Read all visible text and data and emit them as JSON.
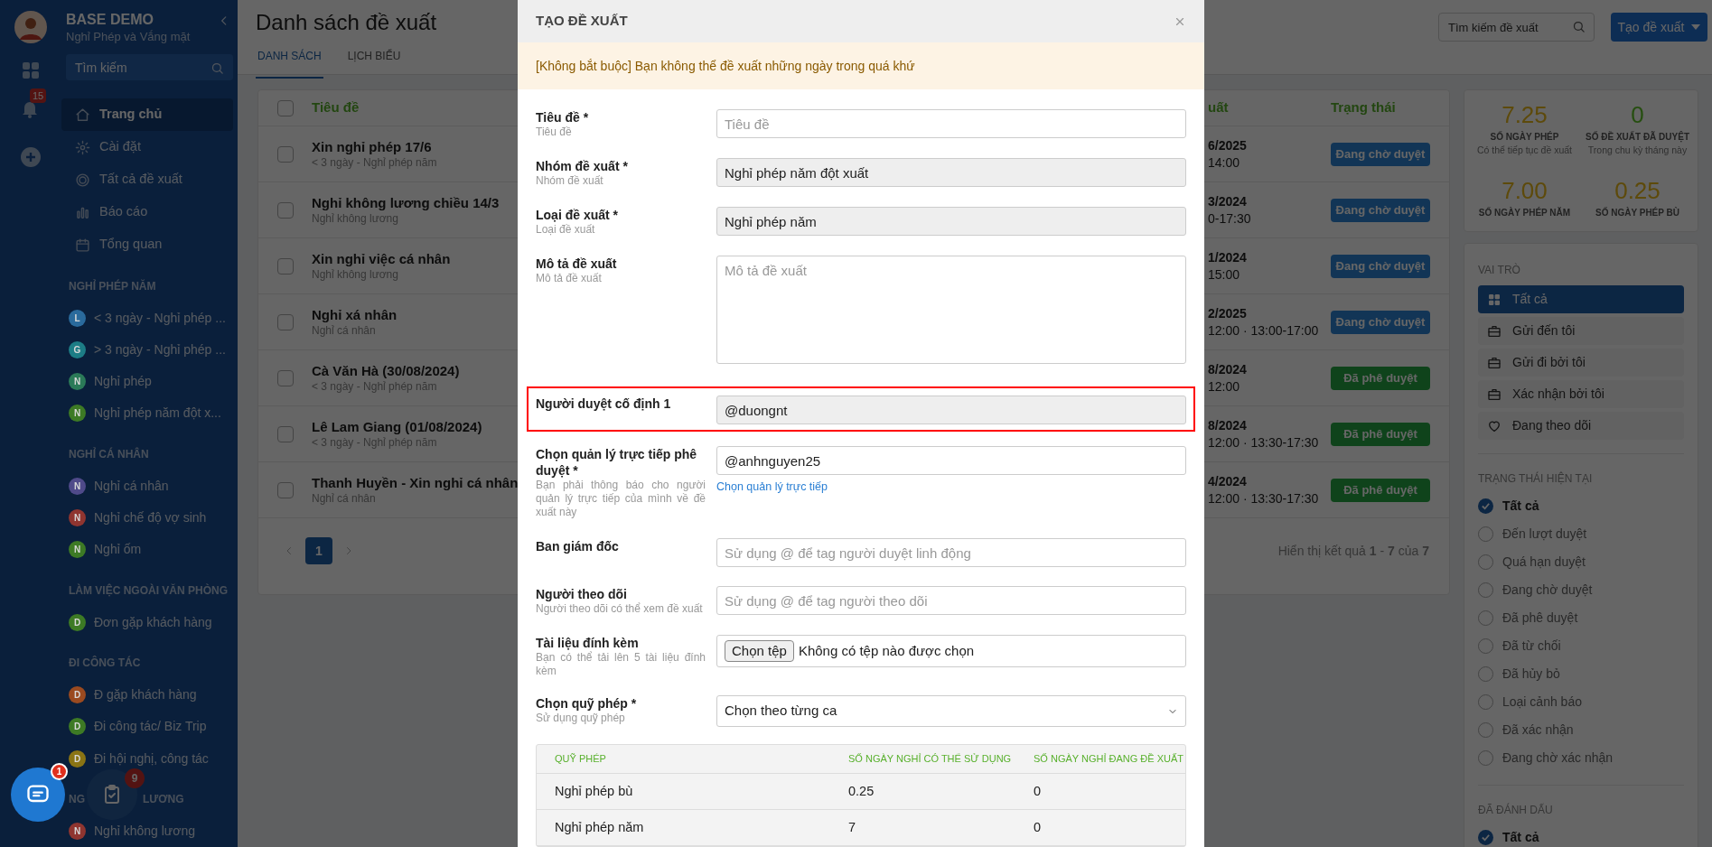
{
  "sidebar": {
    "app_title": "BASE DEMO",
    "app_subtitle": "Nghỉ Phép và Vắng mặt",
    "notification_count": "15",
    "search": {
      "placeholder": "Tìm kiếm"
    },
    "nav": [
      {
        "label": "Trang chủ",
        "selected": true
      },
      {
        "label": "Cài đặt",
        "selected": false
      },
      {
        "label": "Tất cả đề xuất",
        "selected": false
      },
      {
        "label": "Báo cáo",
        "selected": false
      },
      {
        "label": "Tổng quan",
        "selected": false
      }
    ],
    "sections": [
      {
        "heading": "NGHỈ PHÉP NĂM",
        "items": [
          {
            "letter": "L",
            "label": "< 3 ngày - Nghỉ phép ...",
            "color": "#2a6a9c"
          },
          {
            "letter": "G",
            "label": "> 3 ngày - Nghỉ phép ...",
            "color": "#1d7d86"
          },
          {
            "letter": "N",
            "label": "Nghỉ phép",
            "color": "#2b7a58"
          },
          {
            "letter": "N",
            "label": "Nghỉ phép năm đột x...",
            "color": "#3d7a25"
          }
        ]
      },
      {
        "heading": "NGHỈ CÁ NHÂN",
        "items": [
          {
            "letter": "N",
            "label": "Nghỉ cá nhân",
            "color": "#4f4a8a"
          },
          {
            "letter": "N",
            "label": "Nghỉ chế độ vợ sinh",
            "color": "#8f3530"
          },
          {
            "letter": "N",
            "label": "Nghỉ ốm",
            "color": "#3d7a25"
          }
        ]
      },
      {
        "heading": "LÀM VIỆC NGOÀI VĂN PHÒNG",
        "items": [
          {
            "letter": "D",
            "label": "Đơn gặp khách hàng",
            "color": "#3d7a25"
          }
        ]
      },
      {
        "heading": "ĐI CÔNG TÁC",
        "items": [
          {
            "letter": "D",
            "label": "Đ gặp khách hàng",
            "color": "#9a4a20"
          },
          {
            "letter": "D",
            "label": "Đi công tác/ Biz Trip",
            "color": "#3d7a25"
          },
          {
            "letter": "D",
            "label": "Đi hội nghị, công tác",
            "color": "#8a7414"
          }
        ]
      },
      {
        "heading_parts": [
          "NG",
          "LƯƠNG"
        ],
        "items": [
          {
            "letter": "N",
            "label": "Nghỉ không lương",
            "color": "#8f3530"
          }
        ]
      }
    ]
  },
  "floating": {
    "chat_badge": "1",
    "tasks_badge": "9"
  },
  "page": {
    "title": "Danh sách đề xuất",
    "tabs": [
      {
        "label": "DANH SÁCH",
        "selected": true
      },
      {
        "label": "LỊCH BIỂU",
        "selected": false
      }
    ],
    "search": {
      "placeholder": "Tìm kiếm đề xuất"
    },
    "create_button": "Tạo đề xuất"
  },
  "table": {
    "select_all": {
      "checked": false
    },
    "columns": [
      "Tiêu đề",
      "uất",
      "Trạng thái"
    ],
    "rows": [
      {
        "checked": false,
        "title": "Xin nghỉ phép 17/6",
        "subtitle": "< 3 ngày - Nghỉ phép năm",
        "date": "6/2025",
        "time": "14:00",
        "status": "Đang chờ duyệt",
        "kind": "pending"
      },
      {
        "checked": false,
        "title": "Nghỉ không lương chiều 14/3",
        "subtitle": "Nghỉ không lương",
        "date": "3/2024",
        "time": "0-17:30",
        "status": "Đang chờ duyệt",
        "kind": "pending"
      },
      {
        "checked": false,
        "title": "Xin nghỉ việc cá nhân",
        "subtitle": "Nghỉ không lương",
        "date": "1/2024",
        "time": "15:00",
        "status": "Đang chờ duyệt",
        "kind": "pending"
      },
      {
        "checked": false,
        "title": "Nghỉ xá nhân",
        "subtitle": "Nghỉ cá nhân",
        "date": "2/2025",
        "time": "12:00 · 13:00-17:00",
        "status": "Đang chờ duyệt",
        "kind": "pending"
      },
      {
        "checked": false,
        "title": "Cà Văn Hà (30/08/2024)",
        "subtitle": "< 3 ngày - Nghỉ phép năm",
        "date": "8/2024",
        "time": "12:00",
        "status": "Đã phê duyệt",
        "kind": "approved"
      },
      {
        "checked": false,
        "title": "Lê Lam Giang (01/08/2024)",
        "subtitle": "< 3 ngày - Nghỉ phép năm",
        "date": "8/2024",
        "time": "12:00 · 13:30-17:30",
        "status": "Đã phê duyệt",
        "kind": "approved"
      },
      {
        "checked": false,
        "title": "Thanh Huyền - Xin nghỉ cá nhân",
        "subtitle": "Nghỉ cá nhân",
        "date": "4/2024",
        "time": "12:00 · 13:30-17:30",
        "status": "Đã phê duyệt",
        "kind": "approved"
      }
    ],
    "pages": [
      {
        "label": "1",
        "selected": true
      }
    ],
    "summary": "Hiển thị kết quả **1** - **7** của **7**"
  },
  "stats": [
    {
      "value": "7.25",
      "label": "SỐ NGÀY PHÉP",
      "note": "Có thể tiếp tục đề xuất",
      "kind": "days"
    },
    {
      "value": "0",
      "label": "SỐ ĐỀ XUẤT ĐÃ DUYỆT",
      "note": "Trong chu kỳ tháng này",
      "kind": "count"
    },
    {
      "value": "7.00",
      "label": "SỐ NGÀY PHÉP NĂM",
      "kind": "days"
    },
    {
      "value": "0.25",
      "label": "SỐ NGÀY PHÉP BÙ",
      "kind": "days"
    }
  ],
  "filters": {
    "role": {
      "heading": "VAI TRÒ",
      "items": [
        {
          "label": "Tất cả",
          "selected": true
        },
        {
          "label": "Gửi đến tôi",
          "selected": false
        },
        {
          "label": "Gửi đi bởi tôi",
          "selected": false
        },
        {
          "label": "Xác nhận bởi tôi",
          "selected": false
        },
        {
          "label": "Đang theo dõi",
          "selected": false
        }
      ]
    },
    "status": {
      "heading": "TRẠNG THÁI HIỆN TẠI",
      "items": [
        {
          "label": "Tất cả",
          "checked": true
        },
        {
          "label": "Đến lượt duyệt",
          "checked": false
        },
        {
          "label": "Quá hạn duyệt",
          "checked": false
        },
        {
          "label": "Đang chờ duyệt",
          "checked": false
        },
        {
          "label": "Đã phê duyệt",
          "checked": false
        },
        {
          "label": "Đã từ chối",
          "checked": false
        },
        {
          "label": "Đã hủy bỏ",
          "checked": false
        },
        {
          "label": "Loại cảnh báo",
          "checked": false
        },
        {
          "label": "Đã xác nhận",
          "checked": false
        },
        {
          "label": "Đang chờ xác nhận",
          "checked": false
        }
      ]
    },
    "marked": {
      "heading": "ĐÃ ĐÁNH DẤU",
      "items": [
        {
          "label": "Tất cả",
          "checked": true
        }
      ]
    }
  },
  "modal": {
    "title": "TẠO ĐỀ XUẤT",
    "notice": "[Không bắt buộc] Bạn không thể đề xuất những ngày trong quá khứ",
    "fields": [
      {
        "kind": "text",
        "label": "Tiêu đề *",
        "hint": "Tiêu đề",
        "placeholder": "Tiêu đề",
        "disabled": false
      },
      {
        "kind": "text",
        "label": "Nhóm đề xuất *",
        "hint": "Nhóm đề xuất",
        "value": "Nghỉ phép năm đột xuất",
        "disabled": true
      },
      {
        "kind": "text",
        "label": "Loại đề xuất *",
        "hint": "Loại đề xuất",
        "value": "Nghỉ phép năm",
        "disabled": true
      },
      {
        "kind": "textarea",
        "label": "Mô tả đề xuất",
        "hint": "Mô tả đề xuất",
        "placeholder": "Mô tả đề xuất"
      },
      {
        "kind": "text",
        "label": "Người duyệt cố định 1",
        "value": "@duongnt",
        "disabled": true,
        "highlighted": true
      },
      {
        "kind": "text",
        "label": "Chọn quản lý trực tiếp phê duyệt *",
        "hint": "Bạn phải thông báo cho người quản lý trực tiếp của mình về đề xuất này",
        "value": "@anhnguyen25",
        "disabled": false,
        "link": "Chọn quản lý trực tiếp"
      },
      {
        "kind": "text",
        "label": "Ban giám đốc",
        "placeholder": "Sử dụng @ để tag người duyệt linh động",
        "disabled": false
      },
      {
        "kind": "text",
        "label": "Người theo dõi",
        "hint": "Người theo dõi có thể xem đề xuất",
        "placeholder": "Sử dụng @ để tag người theo dõi",
        "disabled": false
      },
      {
        "kind": "file",
        "label": "Tài liệu đính kèm",
        "hint": "Bạn có thể tải lên 5 tài liệu đính kèm",
        "button": "Chọn tệp",
        "status": "Không có tệp nào được chọn"
      },
      {
        "kind": "select",
        "label": "Chọn quỹ phép *",
        "hint": "Sử dụng quỹ phép",
        "value": "Chọn theo từng ca"
      }
    ],
    "quota_table": {
      "columns": [
        "QUỸ PHÉP",
        "SỐ NGÀY NGHỈ CÓ THỂ SỬ DỤNG",
        "SỐ NGÀY NGHỈ ĐANG ĐỀ XUẤT"
      ],
      "rows": [
        [
          "Nghỉ phép bù",
          "0.25",
          "0"
        ],
        [
          "Nghỉ phép năm",
          "7",
          "0"
        ]
      ]
    }
  }
}
